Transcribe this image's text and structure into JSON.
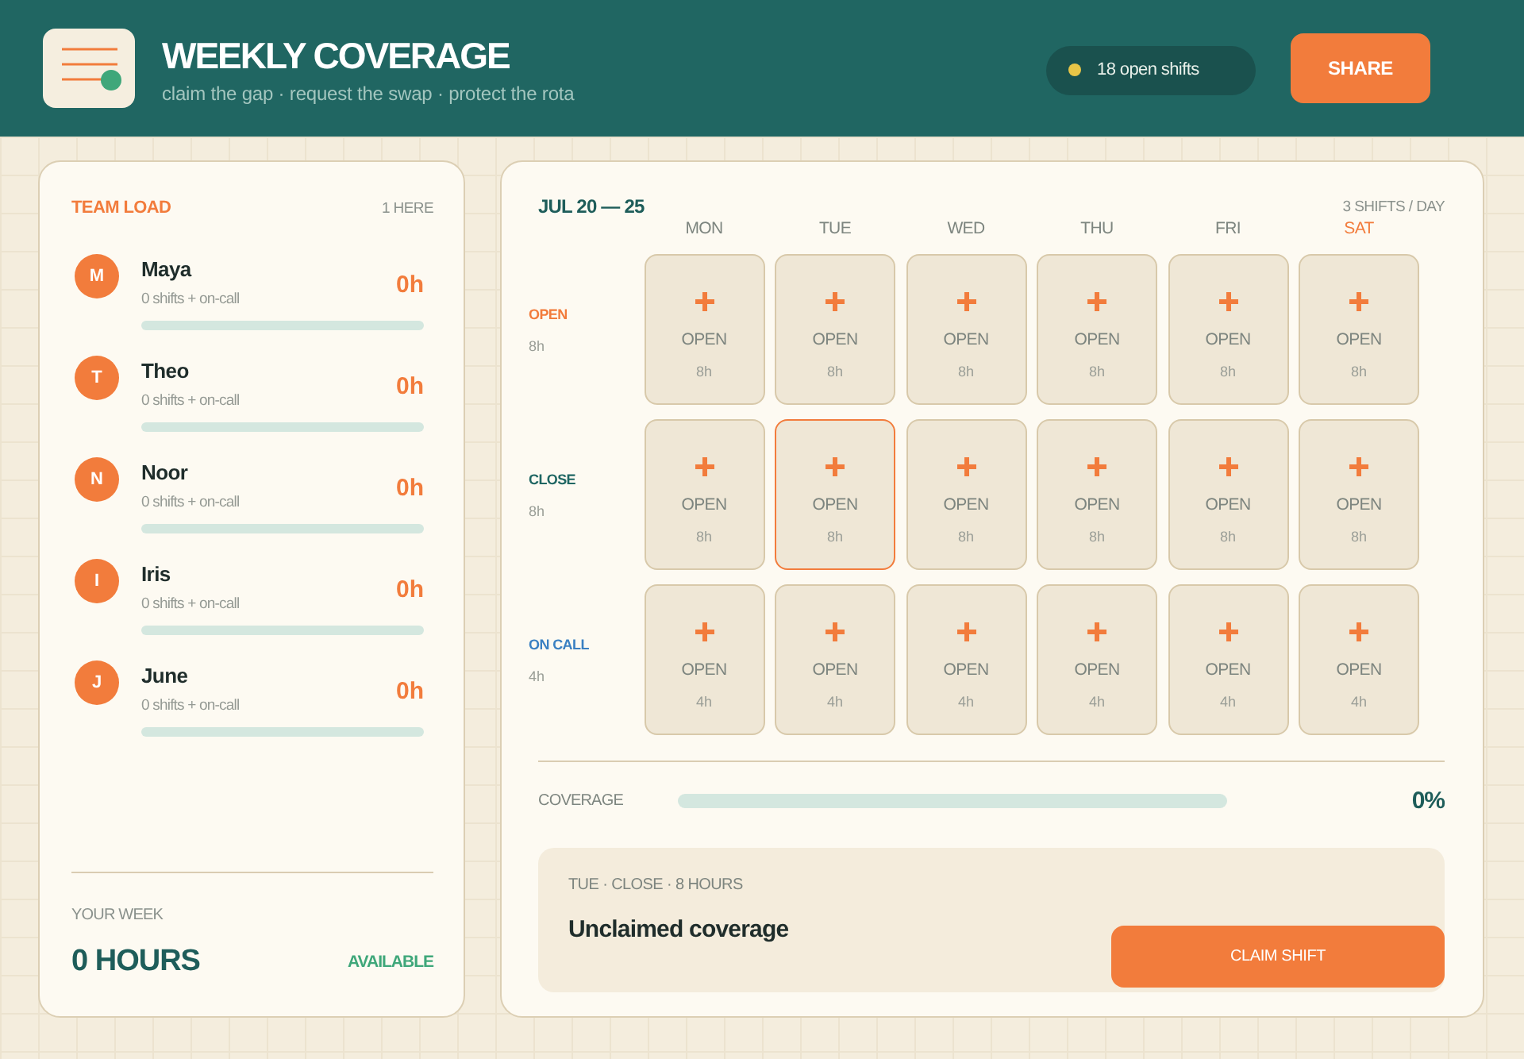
{
  "header": {
    "title": "WEEKLY COVERAGE",
    "subtitle": "claim the gap · request the swap · protect the rota",
    "open_shifts": "18 open shifts",
    "share_button": "SHARE"
  },
  "team_load": {
    "title": "TEAM LOAD",
    "count": "1 HERE",
    "members": [
      {
        "initial": "M",
        "name": "Maya",
        "detail": "0 shifts + on-call",
        "hours": "0h"
      },
      {
        "initial": "T",
        "name": "Theo",
        "detail": "0 shifts + on-call",
        "hours": "0h"
      },
      {
        "initial": "N",
        "name": "Noor",
        "detail": "0 shifts + on-call",
        "hours": "0h"
      },
      {
        "initial": "I",
        "name": "Iris",
        "detail": "0 shifts + on-call",
        "hours": "0h"
      },
      {
        "initial": "J",
        "name": "June",
        "detail": "0 shifts + on-call",
        "hours": "0h"
      }
    ]
  },
  "your_week": {
    "label": "YOUR WEEK",
    "hours": "0 HOURS",
    "status": "AVAILABLE"
  },
  "schedule": {
    "range": "JUL 20 — 25",
    "per_day": "3 SHIFTS / DAY",
    "days": [
      {
        "label": "MON",
        "today": false
      },
      {
        "label": "TUE",
        "today": false
      },
      {
        "label": "WED",
        "today": false
      },
      {
        "label": "THU",
        "today": false
      },
      {
        "label": "FRI",
        "today": false
      },
      {
        "label": "SAT",
        "today": true
      }
    ],
    "shifts": [
      {
        "label": "OPEN",
        "hours": "8h",
        "color": "#f27c3c",
        "cells": [
          {
            "status": "OPEN",
            "hours": "8h",
            "selected": false
          },
          {
            "status": "OPEN",
            "hours": "8h",
            "selected": false
          },
          {
            "status": "OPEN",
            "hours": "8h",
            "selected": false
          },
          {
            "status": "OPEN",
            "hours": "8h",
            "selected": false
          },
          {
            "status": "OPEN",
            "hours": "8h",
            "selected": false
          },
          {
            "status": "OPEN",
            "hours": "8h",
            "selected": false
          }
        ]
      },
      {
        "label": "CLOSE",
        "hours": "8h",
        "color": "#1f6663",
        "cells": [
          {
            "status": "OPEN",
            "hours": "8h",
            "selected": false
          },
          {
            "status": "OPEN",
            "hours": "8h",
            "selected": true
          },
          {
            "status": "OPEN",
            "hours": "8h",
            "selected": false
          },
          {
            "status": "OPEN",
            "hours": "8h",
            "selected": false
          },
          {
            "status": "OPEN",
            "hours": "8h",
            "selected": false
          },
          {
            "status": "OPEN",
            "hours": "8h",
            "selected": false
          }
        ]
      },
      {
        "label": "ON CALL",
        "hours": "4h",
        "color": "#3a80c2",
        "cells": [
          {
            "status": "OPEN",
            "hours": "4h",
            "selected": false
          },
          {
            "status": "OPEN",
            "hours": "4h",
            "selected": false
          },
          {
            "status": "OPEN",
            "hours": "4h",
            "selected": false
          },
          {
            "status": "OPEN",
            "hours": "4h",
            "selected": false
          },
          {
            "status": "OPEN",
            "hours": "4h",
            "selected": false
          },
          {
            "status": "OPEN",
            "hours": "4h",
            "selected": false
          }
        ]
      }
    ]
  },
  "coverage": {
    "label": "COVERAGE",
    "reading": "0%"
  },
  "selection": {
    "meta": "TUE · CLOSE · 8 HOURS",
    "title": "Unclaimed coverage",
    "action": "CLAIM SHIFT"
  }
}
